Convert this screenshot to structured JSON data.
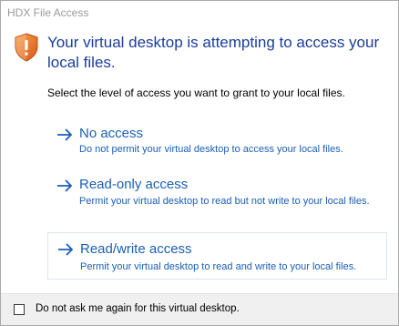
{
  "window": {
    "title": "HDX File Access"
  },
  "header": {
    "icon": "shield-warning-icon",
    "headline": "Your virtual desktop is attempting to access your local files.",
    "instruction": "Select the level of access you want to grant to your local files."
  },
  "options": [
    {
      "icon": "arrow-right-icon",
      "title": "No access",
      "description": "Do not permit your virtual desktop to access your local files."
    },
    {
      "icon": "arrow-right-icon",
      "title": "Read-only access",
      "description": "Permit your virtual desktop to read but not write to your local files."
    },
    {
      "icon": "arrow-right-icon",
      "title": "Read/write access",
      "description": "Permit your virtual desktop to read and write to your local files."
    }
  ],
  "footer": {
    "checkbox_checked": false,
    "checkbox_label": "Do not ask me again for this virtual desktop."
  },
  "colors": {
    "headline": "#1a3d9c",
    "link": "#1a5fb4",
    "shield": "#e8731c",
    "footer_bg": "#f0f0f0"
  }
}
